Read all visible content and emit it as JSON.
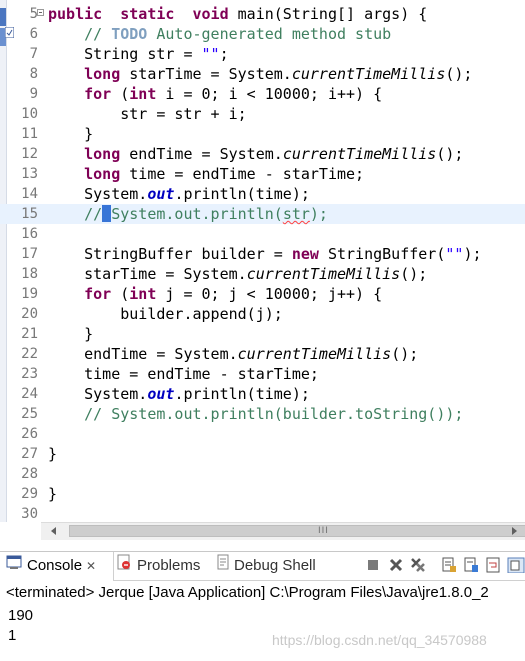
{
  "editor": {
    "lines": [
      {
        "no": "5",
        "fold": true,
        "segments": [
          [
            "kw",
            "public"
          ],
          [
            "",
            "  "
          ],
          [
            "kw",
            "static"
          ],
          [
            "",
            "  "
          ],
          [
            "kw",
            "void"
          ],
          [
            "",
            " main(String[] args) {"
          ]
        ]
      },
      {
        "no": "6",
        "warn": true,
        "segments": [
          [
            "",
            "    "
          ],
          [
            "cm",
            "// "
          ],
          [
            "td",
            "TODO"
          ],
          [
            "cm",
            " Auto-generated method stub"
          ]
        ]
      },
      {
        "no": "7",
        "segments": [
          [
            "",
            "    String "
          ],
          [
            "",
            "str"
          ],
          [
            "",
            " = "
          ],
          [
            "st",
            "\"\""
          ],
          [
            "",
            ";"
          ]
        ]
      },
      {
        "no": "8",
        "segments": [
          [
            "",
            "    "
          ],
          [
            "kw",
            "long"
          ],
          [
            "",
            " starTime = System."
          ],
          [
            "it",
            "currentTimeMillis"
          ],
          [
            "",
            "();"
          ]
        ]
      },
      {
        "no": "9",
        "segments": [
          [
            "",
            "    "
          ],
          [
            "kw",
            "for"
          ],
          [
            "",
            " ("
          ],
          [
            "kw",
            "int"
          ],
          [
            "",
            " i = 0; i < 10000; i++) {"
          ]
        ]
      },
      {
        "no": "10",
        "segments": [
          [
            "",
            "        str = str + i;"
          ]
        ]
      },
      {
        "no": "11",
        "segments": [
          [
            "",
            "    }"
          ]
        ]
      },
      {
        "no": "12",
        "segments": [
          [
            "",
            "    "
          ],
          [
            "kw",
            "long"
          ],
          [
            "",
            " endTime = System."
          ],
          [
            "it",
            "currentTimeMillis"
          ],
          [
            "",
            "();"
          ]
        ]
      },
      {
        "no": "13",
        "segments": [
          [
            "",
            "    "
          ],
          [
            "kw",
            "long"
          ],
          [
            "",
            " time = endTime - starTime;"
          ]
        ]
      },
      {
        "no": "14",
        "segments": [
          [
            "",
            "    System."
          ],
          [
            "fd",
            "out"
          ],
          [
            "",
            ".println(time);"
          ]
        ]
      },
      {
        "no": "15",
        "current": true,
        "segments": [
          [
            "",
            "    "
          ],
          [
            "cm",
            "//"
          ],
          [
            "caret",
            ""
          ],
          [
            "cm",
            " System.out.println("
          ],
          [
            "cmsq",
            "str"
          ],
          [
            "cm",
            ");"
          ]
        ]
      },
      {
        "no": "16",
        "segments": []
      },
      {
        "no": "17",
        "segments": [
          [
            "",
            "    StringBuffer builder = "
          ],
          [
            "kw",
            "new"
          ],
          [
            "",
            " StringBuffer("
          ],
          [
            "st",
            "\"\""
          ],
          [
            "",
            ");"
          ]
        ]
      },
      {
        "no": "18",
        "segments": [
          [
            "",
            "    starTime = System."
          ],
          [
            "it",
            "currentTimeMillis"
          ],
          [
            "",
            "();"
          ]
        ]
      },
      {
        "no": "19",
        "segments": [
          [
            "",
            "    "
          ],
          [
            "kw",
            "for"
          ],
          [
            "",
            " ("
          ],
          [
            "kw",
            "int"
          ],
          [
            "",
            " j = 0; j < 10000; j++) {"
          ]
        ]
      },
      {
        "no": "20",
        "segments": [
          [
            "",
            "        builder.append(j);"
          ]
        ]
      },
      {
        "no": "21",
        "segments": [
          [
            "",
            "    }"
          ]
        ]
      },
      {
        "no": "22",
        "segments": [
          [
            "",
            "    endTime = System."
          ],
          [
            "it",
            "currentTimeMillis"
          ],
          [
            "",
            "();"
          ]
        ]
      },
      {
        "no": "23",
        "segments": [
          [
            "",
            "    time = endTime - starTime;"
          ]
        ]
      },
      {
        "no": "24",
        "segments": [
          [
            "",
            "    System."
          ],
          [
            "fd",
            "out"
          ],
          [
            "",
            ".println(time);"
          ]
        ]
      },
      {
        "no": "25",
        "segments": [
          [
            "",
            "    "
          ],
          [
            "cm",
            "// System.out.println(builder.toString());"
          ]
        ]
      },
      {
        "no": "26",
        "segments": []
      },
      {
        "no": "27",
        "segments": [
          [
            "",
            "}"
          ]
        ]
      },
      {
        "no": "28",
        "segments": []
      },
      {
        "no": "29",
        "segments": [
          [
            "",
            "}"
          ]
        ]
      },
      {
        "no": "30",
        "segments": []
      }
    ],
    "indent_prefix": [
      "5",
      "6",
      "7",
      "8",
      "9",
      "10",
      "11",
      "12",
      "13",
      "14",
      "15",
      "16",
      "17",
      "18",
      "19",
      "20",
      "21",
      "22",
      "23",
      "24",
      "25",
      "26",
      "27",
      "28",
      "29",
      "30"
    ]
  },
  "scrollbar": {
    "grip": "III"
  },
  "views": {
    "tabs": [
      {
        "label": "Console",
        "close": "✕",
        "icon": "console-icon",
        "active": true
      },
      {
        "label": "Problems",
        "icon": "problems-icon"
      },
      {
        "label": "Debug Shell",
        "icon": "debug-shell-icon"
      }
    ]
  },
  "console": {
    "header": "<terminated> Jerque [Java Application] C:\\Program Files\\Java\\jre1.8.0_2",
    "output": [
      "190",
      "1"
    ]
  },
  "watermark": "https://blog.csdn.net/qq_34570988",
  "colors": {
    "keyword": "#7f0055",
    "comment": "#3f7f5f",
    "string": "#2a00ff",
    "field": "#0000c0",
    "todo": "#7f9fbf",
    "current_line": "#e8f2fe"
  }
}
